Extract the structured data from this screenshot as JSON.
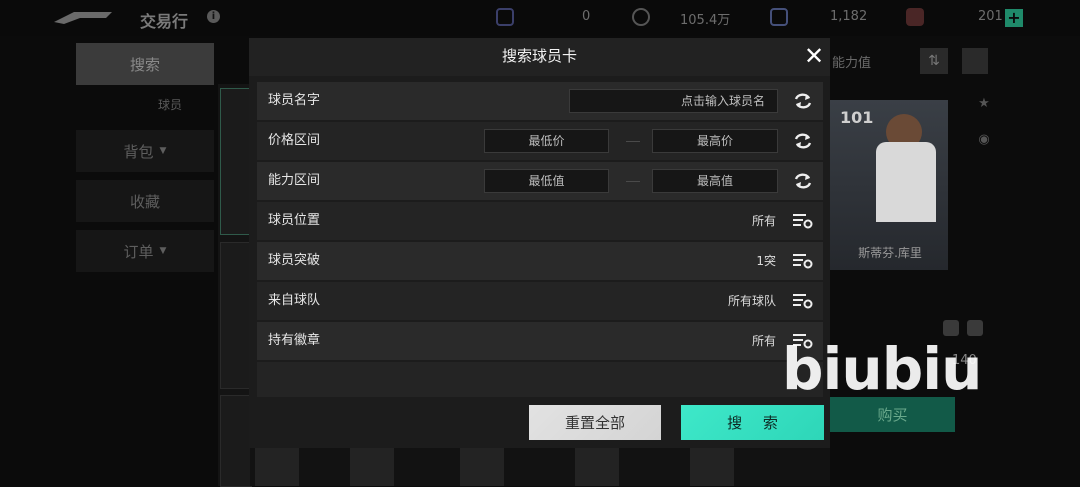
{
  "app": {
    "title": "交易行",
    "info_icon": "i",
    "currencies": [
      {
        "icon": "coin-badge-icon",
        "value": "0"
      },
      {
        "icon": "clock-icon",
        "value": "105.4万"
      },
      {
        "icon": "token-icon",
        "value": "1,182"
      },
      {
        "icon": "card-pack-icon",
        "value": "201"
      }
    ],
    "plus_label": "+"
  },
  "sidebar": {
    "items": [
      {
        "label": "搜索"
      },
      {
        "label": "球员"
      },
      {
        "label": "背包"
      },
      {
        "label": "收藏"
      },
      {
        "label": "订单"
      }
    ]
  },
  "right_panel": {
    "sort_label": "能力值",
    "sort_icon": "⇅",
    "card_rating": "101",
    "player_name": "斯蒂芬.库里",
    "price": "140",
    "buy_label": "购买"
  },
  "dialog": {
    "title": "搜索球员卡",
    "close_label": "✕",
    "name_row": {
      "label": "球员名字",
      "placeholder": "点击输入球员名"
    },
    "price_row": {
      "label": "价格区间",
      "min": "最低价",
      "max": "最高价"
    },
    "ability_row": {
      "label": "能力区间",
      "min": "最低值",
      "max": "最高值"
    },
    "filters": [
      {
        "label": "球员位置",
        "value": "所有"
      },
      {
        "label": "球员突破",
        "value": "1突"
      },
      {
        "label": "来自球队",
        "value": "所有球队"
      },
      {
        "label": "持有徽章",
        "value": "所有"
      }
    ],
    "reset_label": "重置全部",
    "search_label": "搜 索"
  },
  "watermark": "biubiu",
  "colors": {
    "accent": "#3ee8c9",
    "buy": "#125a48",
    "dialog_bg": "#1c1c1c"
  }
}
